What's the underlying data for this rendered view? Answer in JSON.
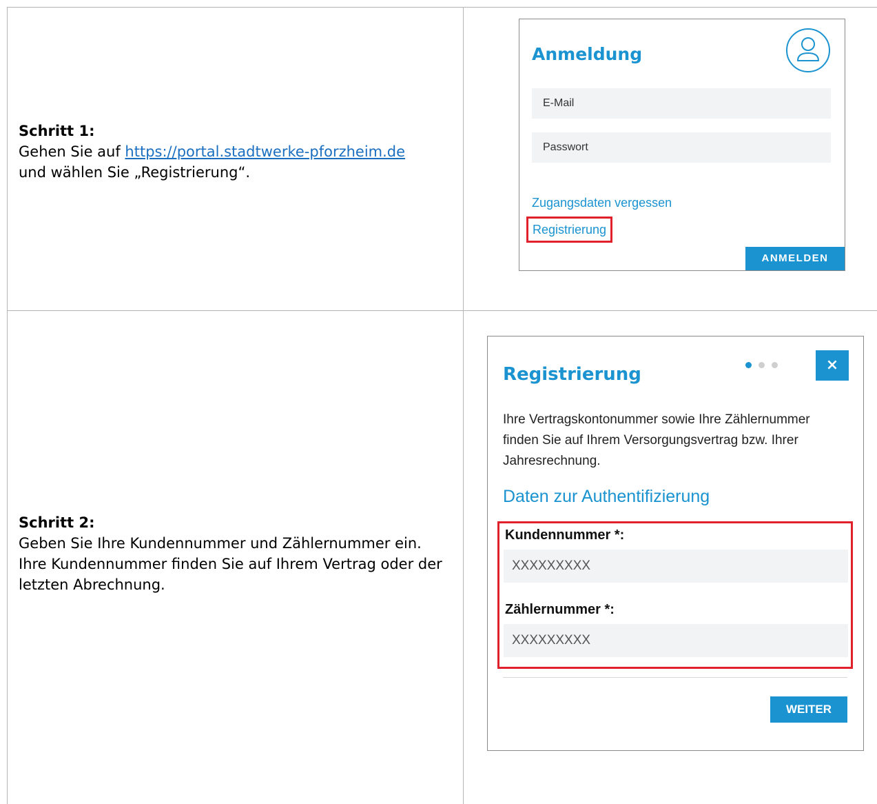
{
  "steps": [
    {
      "title": "Schritt 1:",
      "text_before_link": "Gehen Sie auf ",
      "link": "https://portal.stadtwerke-pforzheim.de",
      "text_after_link": "und wählen Sie „Registrierung“."
    },
    {
      "title": "Schritt 2:",
      "text": "Geben Sie Ihre Kundennummer und Zählernummer ein. Ihre Kundennummer finden Sie auf Ihrem Vertrag oder der letzten Abrechnung."
    }
  ],
  "login": {
    "title": "Anmeldung",
    "email_placeholder": "E-Mail",
    "password_placeholder": "Passwort",
    "forgot_link": "Zugangsdaten vergessen",
    "register_link": "Registrierung",
    "submit_label": "ANMELDEN"
  },
  "registration": {
    "title": "Registrierung",
    "close_label": "×",
    "description": "Ihre Vertragskontonummer sowie Ihre Zählernummer finden Sie auf Ihrem Versorgungsvertrag bzw. Ihrer Jahresrechnung.",
    "subtitle": "Daten zur Authentifizierung",
    "customer_label": "Kundennummer *:",
    "customer_value": "XXXXXXXXX",
    "meter_label": "Zählernummer *:",
    "meter_value": "XXXXXXXXX",
    "next_label": "WEITER",
    "progress": {
      "current": 1,
      "total": 3
    }
  },
  "colors": {
    "brand": "#1a93d0",
    "highlight": "#e0202a",
    "link": "#1a6fc0",
    "field_bg": "#f2f3f4"
  }
}
